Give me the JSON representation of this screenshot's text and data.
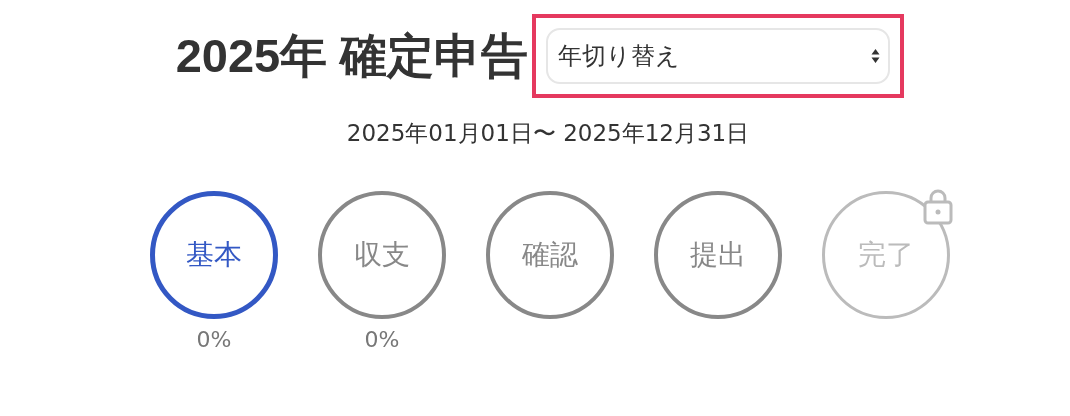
{
  "title": "2025年 確定申告",
  "year_select": {
    "value": "年切り替え",
    "highlighted": true
  },
  "period": "2025年01月01日〜 2025年12月31日",
  "steps": [
    {
      "label": "基本",
      "selected": true,
      "locked": false,
      "percent": "0%"
    },
    {
      "label": "収支",
      "selected": false,
      "locked": false,
      "percent": "0%"
    },
    {
      "label": "確認",
      "selected": false,
      "locked": false
    },
    {
      "label": "提出",
      "selected": false,
      "locked": false
    },
    {
      "label": "完了",
      "selected": false,
      "locked": true
    }
  ]
}
